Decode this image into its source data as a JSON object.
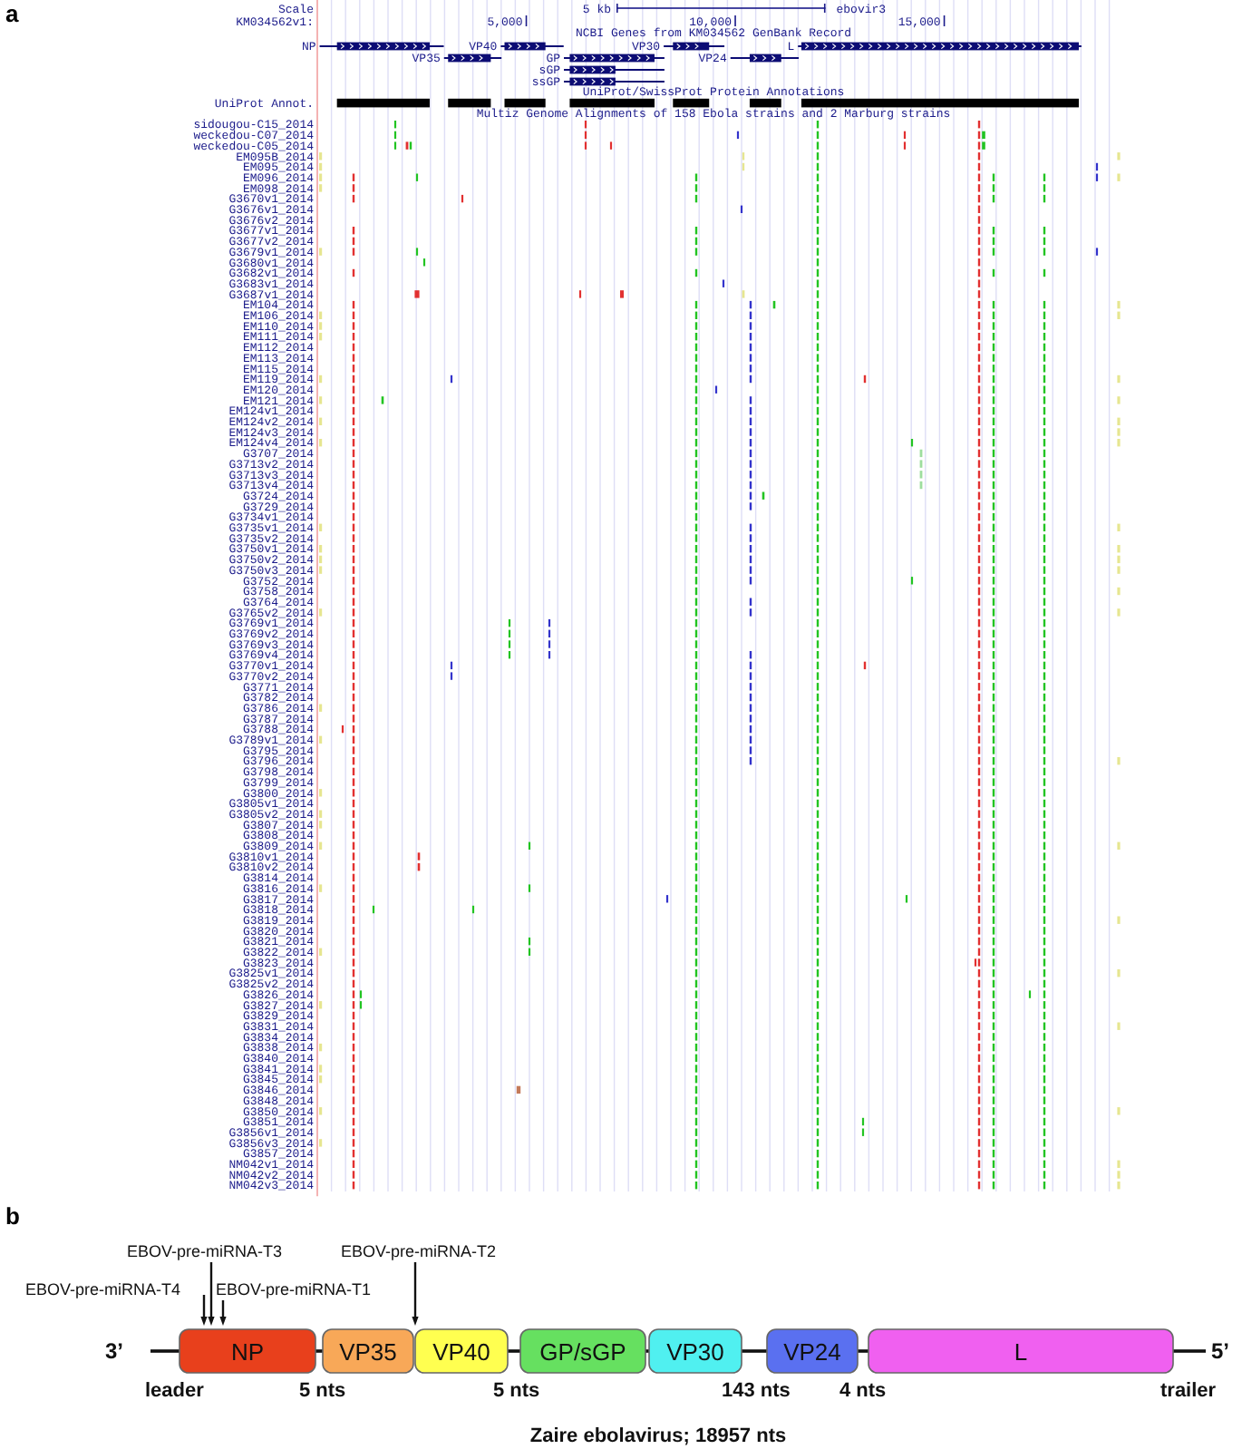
{
  "panel_a": {
    "label": "a",
    "ruler": {
      "scale_label": "Scale",
      "scale_bar_label": "5 kb",
      "assembly": "ebovir3",
      "sequence": "KM034562v1:",
      "ticks": [
        "5,000",
        "10,000",
        "15,000"
      ]
    },
    "gene_track": {
      "title": "NCBI Genes from KM034562 GenBank Record",
      "genes": [
        {
          "label": "NP"
        },
        {
          "label": "VP35"
        },
        {
          "label": "VP40"
        },
        {
          "label": "GP"
        },
        {
          "label": "sGP"
        },
        {
          "label": "ssGP"
        },
        {
          "label": "VP30"
        },
        {
          "label": "VP24"
        },
        {
          "label": "L"
        }
      ]
    },
    "protein_track": {
      "title": "UniProt/SwissProt Protein Annotations",
      "label": "UniProt Annot."
    },
    "alignment_track": {
      "title": "Multiz Genome Alignments of 158 Ebola strains and 2 Marburg strains",
      "strains": [
        "sidougou-C15_2014",
        "weckedou-C07_2014",
        "weckedou-C05_2014",
        "EM095B_2014",
        "EM095_2014",
        "EM096_2014",
        "EM098_2014",
        "G3670v1_2014",
        "G3676v1_2014",
        "G3676v2_2014",
        "G3677v1_2014",
        "G3677v2_2014",
        "G3679v1_2014",
        "G3680v1_2014",
        "G3682v1_2014",
        "G3683v1_2014",
        "G3687v1_2014",
        "EM104_2014",
        "EM106_2014",
        "EM110_2014",
        "EM111_2014",
        "EM112_2014",
        "EM113_2014",
        "EM115_2014",
        "EM119_2014",
        "EM120_2014",
        "EM121_2014",
        "EM124v1_2014",
        "EM124v2_2014",
        "EM124v3_2014",
        "EM124v4_2014",
        "G3707_2014",
        "G3713v2_2014",
        "G3713v3_2014",
        "G3713v4_2014",
        "G3724_2014",
        "G3729_2014",
        "G3734v1_2014",
        "G3735v1_2014",
        "G3735v2_2014",
        "G3750v1_2014",
        "G3750v2_2014",
        "G3750v3_2014",
        "G3752_2014",
        "G3758_2014",
        "G3764_2014",
        "G3765v2_2014",
        "G3769v1_2014",
        "G3769v2_2014",
        "G3769v3_2014",
        "G3769v4_2014",
        "G3770v1_2014",
        "G3770v2_2014",
        "G3771_2014",
        "G3782_2014",
        "G3786_2014",
        "G3787_2014",
        "G3788_2014",
        "G3789v1_2014",
        "G3795_2014",
        "G3796_2014",
        "G3798_2014",
        "G3799_2014",
        "G3800_2014",
        "G3805v1_2014",
        "G3805v2_2014",
        "G3807_2014",
        "G3808_2014",
        "G3809_2014",
        "G3810v1_2014",
        "G3810v2_2014",
        "G3814_2014",
        "G3816_2014",
        "G3817_2014",
        "G3818_2014",
        "G3819_2014",
        "G3820_2014",
        "G3821_2014",
        "G3822_2014",
        "G3823_2014",
        "G3825v1_2014",
        "G3825v2_2014",
        "G3826_2014",
        "G3827_2014",
        "G3829_2014",
        "G3831_2014",
        "G3834_2014",
        "G3838_2014",
        "G3840_2014",
        "G3841_2014",
        "G3845_2014",
        "G3846_2014",
        "G3848_2014",
        "G3850_2014",
        "G3851_2014",
        "G3856v1_2014",
        "G3856v3_2014",
        "G3857_2014",
        "NM042v1_2014",
        "NM042v2_2014",
        "NM042v3_2014"
      ]
    }
  },
  "panel_b": {
    "label": "b",
    "end_3": "3’",
    "end_5": "5’",
    "mirna_arrows": [
      {
        "label": "EBOV-pre-miRNA-T3"
      },
      {
        "label": "EBOV-pre-miRNA-T2"
      },
      {
        "label": "EBOV-pre-miRNA-T4"
      },
      {
        "label": "EBOV-pre-miRNA-T1"
      }
    ],
    "genes": [
      {
        "label": "NP",
        "color": "#e8401c"
      },
      {
        "label": "VP35",
        "color": "#f8a858"
      },
      {
        "label": "VP40",
        "color": "#ffff50"
      },
      {
        "label": "GP/sGP",
        "color": "#66e060"
      },
      {
        "label": "VP30",
        "color": "#50f0f0"
      },
      {
        "label": "VP24",
        "color": "#5a70f0"
      },
      {
        "label": "L",
        "color": "#f060f0"
      }
    ],
    "junctions": [
      "leader",
      "5 nts",
      "5 nts",
      "143 nts",
      "4 nts",
      "trailer"
    ],
    "caption": "Zaire ebolavirus; 18957 nts"
  }
}
